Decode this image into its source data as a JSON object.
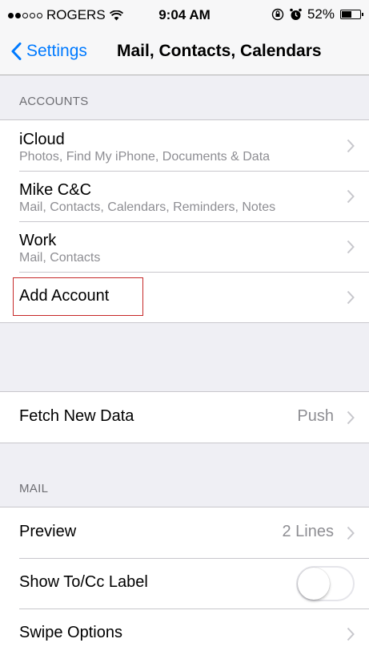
{
  "status_bar": {
    "carrier": "ROGERS",
    "time": "9:04 AM",
    "battery": "52%",
    "signal_bars_filled": 2,
    "signal_bars_total": 5,
    "battery_level": 0.52
  },
  "nav": {
    "back_label": "Settings",
    "title": "Mail, Contacts, Calendars"
  },
  "accounts": {
    "header": "ACCOUNTS",
    "items": [
      {
        "title": "iCloud",
        "subtitle": "Photos, Find My iPhone, Documents & Data"
      },
      {
        "title": "Mike C&C",
        "subtitle": "Mail, Contacts, Calendars, Reminders, Notes"
      },
      {
        "title": "Work",
        "subtitle": "Mail, Contacts"
      }
    ],
    "add_account": "Add Account"
  },
  "fetch": {
    "label": "Fetch New Data",
    "value": "Push"
  },
  "mail": {
    "header": "MAIL",
    "preview_label": "Preview",
    "preview_value": "2 Lines",
    "show_tocc_label": "Show To/Cc Label",
    "show_tocc_on": false,
    "swipe_label": "Swipe Options"
  },
  "colors": {
    "accent": "#007aff",
    "highlight": "#c62828",
    "background": "#efeff4"
  }
}
